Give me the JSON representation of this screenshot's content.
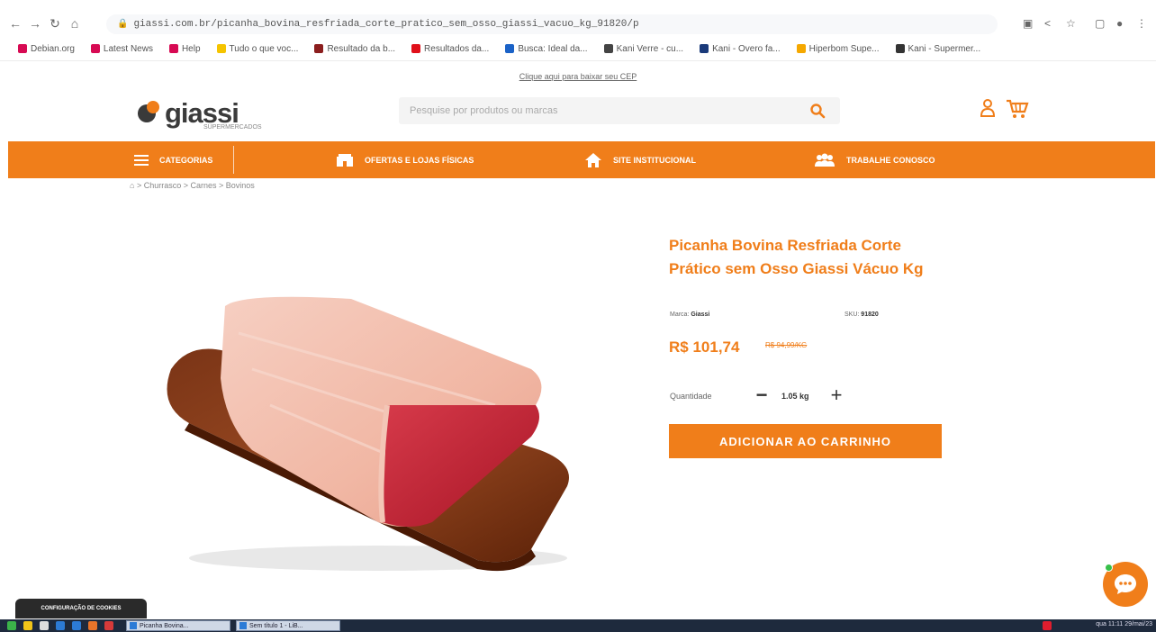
{
  "browser": {
    "url": "giassi.com.br/picanha_bovina_resfriada_corte_pratico_sem_osso_giassi_vacuo_kg_91820/p",
    "bookmarks": [
      "Debian.org",
      "Latest News",
      "Help",
      "Tudo o que voc...",
      "Resultado da b...",
      "Resultados da...",
      "Busca: Ideal da...",
      "Kani Verre - cu...",
      "Kani - Overo fa...",
      "Hiperbom Supe...",
      "Kani - Supermer..."
    ]
  },
  "site": {
    "top_notice": "Clique aqui para baixar seu CEP",
    "logo_text": "giassi",
    "logo_sub": "SUPERMERCADOS",
    "search_placeholder": "Pesquise por produtos ou marcas"
  },
  "nav": {
    "categories": "Categorias",
    "items": [
      "Ofertas e Lojas Físicas",
      "Site Institucional",
      "Trabalhe Conosco"
    ]
  },
  "breadcrumb": "> Churrasco > Carnes > Bovinos",
  "product": {
    "title": "Picanha Bovina Resfriada Corte Prático sem Osso Giassi Vácuo Kg",
    "brand_label": "Marca:",
    "brand_value": "Giassi",
    "sku_label": "SKU:",
    "sku_value": "91820",
    "price": "R$ 101,74",
    "old_price": "R$ 94,99/KG",
    "qty_label": "Quantidade",
    "qty_minus": "−",
    "qty_value": "1.05 kg",
    "qty_plus": "+",
    "add_to_cart": "Adicionar ao Carrinho"
  },
  "cookie": {
    "label": "Configuração de Cookies"
  },
  "taskbar": {
    "tasks": [
      "Picanha Bovina...",
      "Sem título 1 - LiB..."
    ],
    "clock": "qua 11:11 29/mai/23"
  },
  "colors": {
    "brand_orange": "#f07e1a",
    "logo_gray": "#3a3a3a"
  }
}
